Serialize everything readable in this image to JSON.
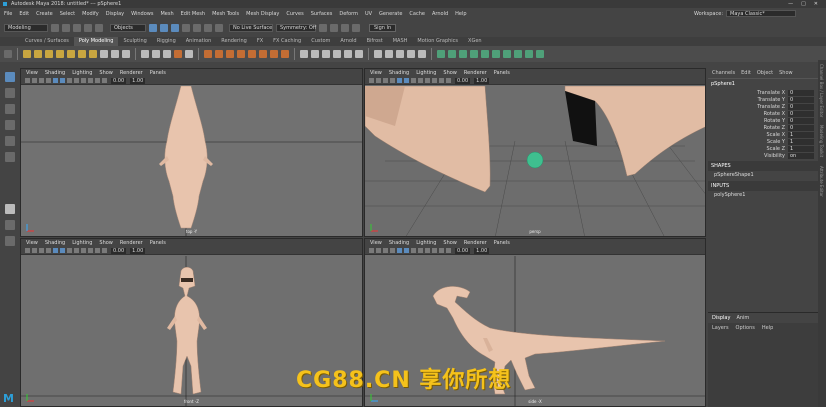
{
  "title_bar": {
    "title": "Autodesk Maya 2018: untitled*   ---   pSphere1",
    "min": "—",
    "max": "□",
    "close": "✕"
  },
  "menu": {
    "items": [
      "File",
      "Edit",
      "Create",
      "Select",
      "Modify",
      "Display",
      "Windows",
      "Mesh",
      "Edit Mesh",
      "Mesh Tools",
      "Mesh Display",
      "Curves",
      "Surfaces",
      "Deform",
      "UV",
      "Generate",
      "Cache",
      "Arnold",
      "Help"
    ],
    "workspace_label": "Workspace:",
    "workspace_value": "Maya Classic*"
  },
  "status_line": {
    "mode": "Modeling",
    "objects": "Objects",
    "live": "No Live Surface",
    "symmetry": "Symmetry: Off",
    "sign_in": "Sign In"
  },
  "shelf_tabs": {
    "items": [
      "Curves / Surfaces",
      "Poly Modeling",
      "Sculpting",
      "Rigging",
      "Animation",
      "Rendering",
      "FX",
      "FX Caching",
      "Custom",
      "Arnold",
      "Bifrost",
      "MASH",
      "Motion Graphics",
      "XGen"
    ],
    "active": 1
  },
  "viewport_menu": [
    "View",
    "Shading",
    "Lighting",
    "Show",
    "Renderer",
    "Panels"
  ],
  "viewports": [
    {
      "camera": "top -Y",
      "values": [
        "0.00",
        "1.00"
      ]
    },
    {
      "camera": "persp",
      "values": [
        "0.00",
        "1.00"
      ]
    },
    {
      "camera": "front -Z",
      "values": [
        "0.00",
        "1.00"
      ]
    },
    {
      "camera": "side -X",
      "values": [
        "0.00",
        "1.00"
      ]
    }
  ],
  "channel_box": {
    "menu": [
      "Channels",
      "Edit",
      "Object",
      "Show"
    ],
    "object": "pSphere1",
    "attributes": [
      {
        "name": "Translate X",
        "value": "0"
      },
      {
        "name": "Translate Y",
        "value": "0"
      },
      {
        "name": "Translate Z",
        "value": "0"
      },
      {
        "name": "Rotate X",
        "value": "0"
      },
      {
        "name": "Rotate Y",
        "value": "0"
      },
      {
        "name": "Rotate Z",
        "value": "0"
      },
      {
        "name": "Scale X",
        "value": "1"
      },
      {
        "name": "Scale Y",
        "value": "1"
      },
      {
        "name": "Scale Z",
        "value": "1"
      },
      {
        "name": "Visibility",
        "value": "on"
      }
    ],
    "shapes_header": "SHAPES",
    "shape": "pSphereShape1",
    "inputs_header": "INPUTS",
    "input": "polySphere1"
  },
  "layer_editor": {
    "tabs": [
      "Display",
      "Anim"
    ],
    "menu": [
      "Layers",
      "Options",
      "Help"
    ]
  },
  "side_tabs": [
    "Channel Box / Layer Editor",
    "Modeling Toolkit",
    "Attribute Editor"
  ],
  "watermark": "CG88.CN 享你所想",
  "maya_logo": "M",
  "colors": {
    "accent": "#5b8bbd",
    "sphere": "#3fbf8f",
    "dino": "#e8c4ad",
    "watermark": "#f5c21b"
  }
}
